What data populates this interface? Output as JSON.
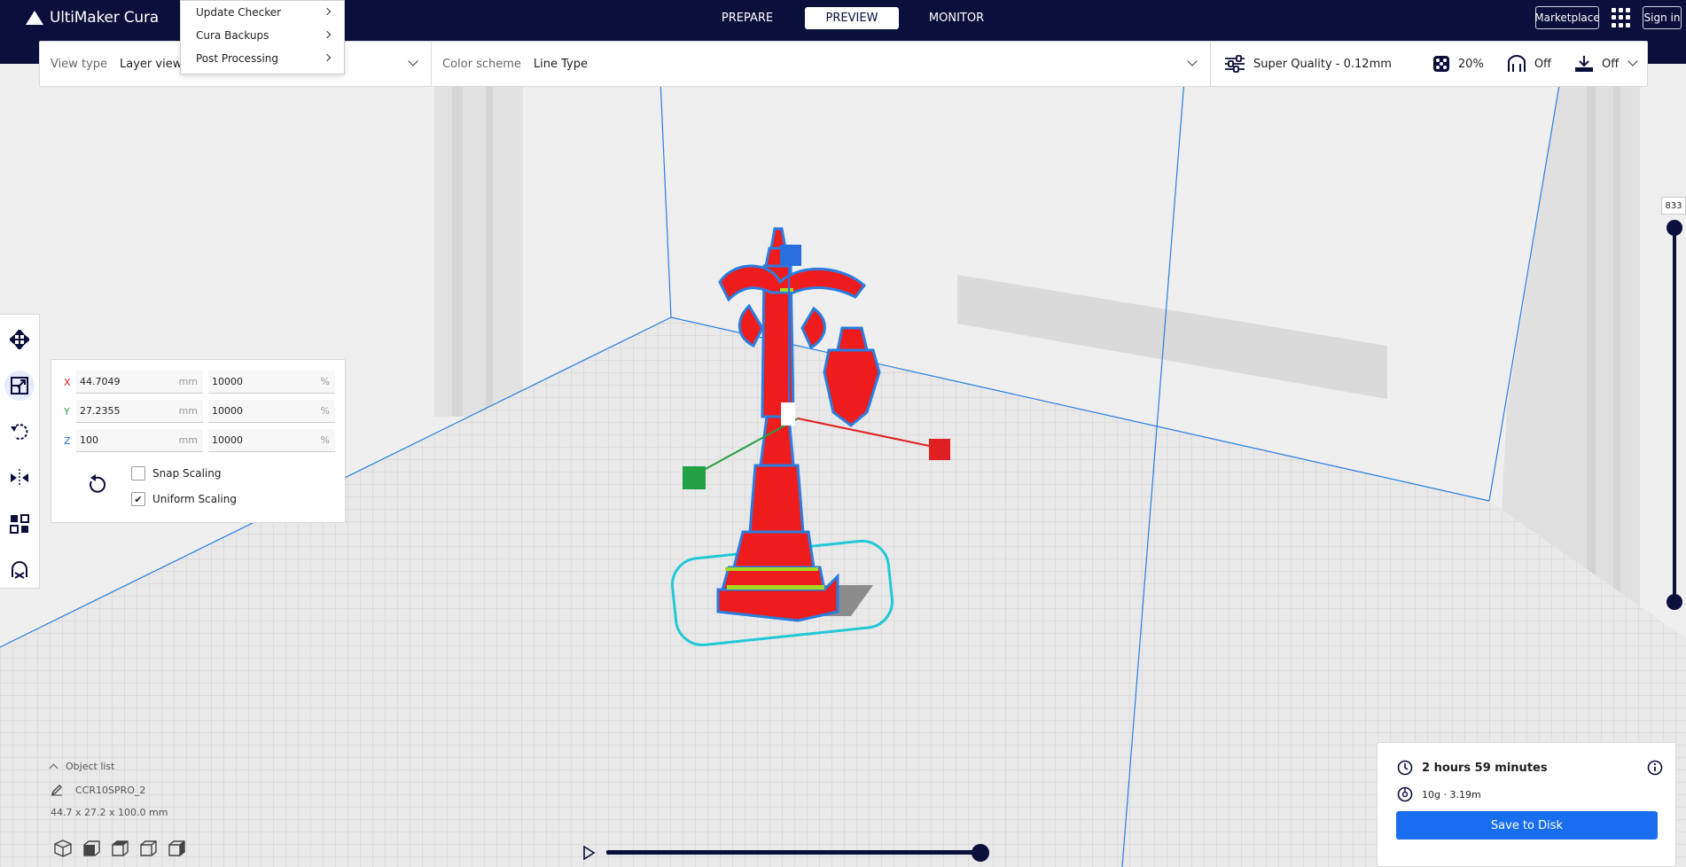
{
  "app": {
    "name": "UltiMaker Cura"
  },
  "header": {
    "tabs": [
      {
        "label": "PREPARE",
        "active": false
      },
      {
        "label": "PREVIEW",
        "active": true
      },
      {
        "label": "MONITOR",
        "active": false
      }
    ],
    "marketplace_label": "Marketplace",
    "apps_icon": "apps-grid-icon",
    "signin_label": "Sign in"
  },
  "extensions_menu": {
    "items": [
      {
        "label": "Update Checker"
      },
      {
        "label": "Cura Backups"
      },
      {
        "label": "Post Processing"
      }
    ]
  },
  "view_bar": {
    "view_type_label": "View type",
    "view_type_value": "Layer view",
    "color_scheme_label": "Color scheme",
    "color_scheme_value": "Line Type",
    "profile": "Super Quality - 0.12mm",
    "infill": "20%",
    "support": "Off",
    "adhesion": "Off"
  },
  "scale_tool": {
    "x": {
      "axis": "X",
      "mm": "44.7049",
      "unit_mm": "mm",
      "percent": "10000",
      "unit_pct": "%"
    },
    "y": {
      "axis": "Y",
      "mm": "27.2355",
      "unit_mm": "mm",
      "percent": "10000",
      "unit_pct": "%"
    },
    "z": {
      "axis": "Z",
      "mm": "100",
      "unit_mm": "mm",
      "percent": "10000",
      "unit_pct": "%"
    },
    "snap_scaling": {
      "label": "Snap Scaling",
      "checked": false
    },
    "uniform_scaling": {
      "label": "Uniform Scaling",
      "checked": true
    }
  },
  "layer_slider": {
    "value": "833"
  },
  "object_list": {
    "title": "Object list",
    "object_name": "CCR10SPRO_2",
    "dimensions": "44.7 x 27.2 x 100.0 mm"
  },
  "print_info": {
    "time": "2 hours 59 minutes",
    "material": "10g · 3.19m",
    "save_label": "Save to Disk"
  },
  "colors": {
    "header_bg": "#0a0f3b",
    "accent_blue": "#196ef0",
    "model_red": "#ee1c1c",
    "outline_blue": "#2a7de1",
    "skirt_cyan": "#22c9d6",
    "axis_x": "#e02020",
    "axis_y": "#22a045",
    "axis_z": "#2a6fe0"
  }
}
